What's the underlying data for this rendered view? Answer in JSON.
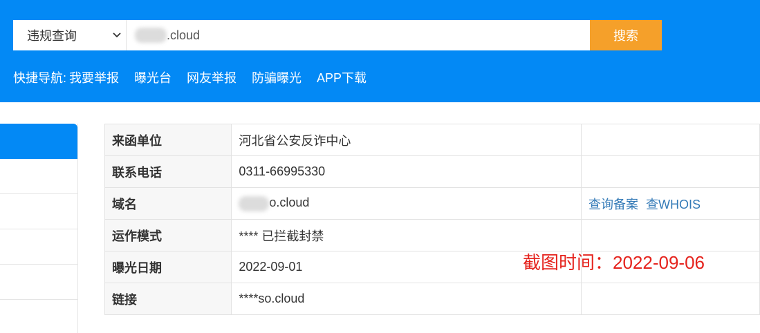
{
  "search": {
    "select_value": "违规查询",
    "query_suffix": ".cloud",
    "button_label": "搜索"
  },
  "quick_nav": {
    "label": "快捷导航:",
    "items": [
      "我要举报",
      "曝光台",
      "网友举报",
      "防骗曝光",
      "APP下载"
    ]
  },
  "info_table": {
    "rows": [
      {
        "key": "来函单位",
        "value": "河北省公安反诈中心"
      },
      {
        "key": "联系电话",
        "value": "0311-66995330"
      },
      {
        "key": "域名",
        "value_suffix": "o.cloud",
        "links": [
          "查询备案",
          "查WHOIS"
        ]
      },
      {
        "key": "运作模式",
        "value": "**** 已拦截封禁"
      },
      {
        "key": "曝光日期",
        "value": "2022-09-01"
      },
      {
        "key": "链接",
        "value": "****so.cloud"
      }
    ]
  },
  "annotation": "截图时间：2022-09-06",
  "colors": {
    "header_blue": "#0389f5",
    "search_button_orange": "#f5a02a",
    "link_blue": "#337ab7",
    "annotation_red": "#e5231d"
  }
}
